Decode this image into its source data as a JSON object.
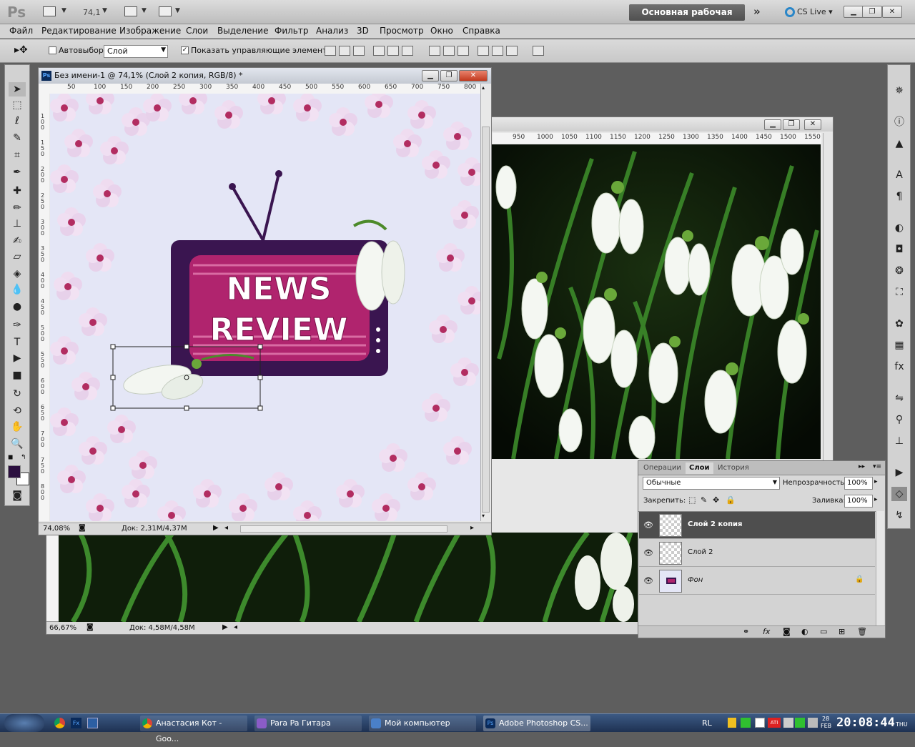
{
  "app": {
    "logo": "Ps",
    "zoom_display": "74,1",
    "workspace": "Основная рабочая среда",
    "cs_live": "CS Live"
  },
  "menu": [
    "Файл",
    "Редактирование",
    "Изображение",
    "Слои",
    "Выделение",
    "Фильтр",
    "Анализ",
    "3D",
    "Просмотр",
    "Окно",
    "Справка"
  ],
  "options": {
    "autoselect_label": "Автовыбор:",
    "autoselect_value": "Слой",
    "show_controls_label": "Показать управляющие элементы"
  },
  "doc1": {
    "title": "Без имени-1 @ 74,1% (Слой 2 копия, RGB/8) *",
    "zoom": "74,08%",
    "doc_size": "Док: 2,31M/4,37M",
    "ruler_ticks": [
      "50",
      "100",
      "150",
      "200",
      "250",
      "300",
      "350",
      "400",
      "450",
      "500",
      "550",
      "600",
      "650",
      "700",
      "750",
      "800"
    ],
    "vruler_ticks": [
      "1 0 0",
      "1 5 0",
      "2 0 0",
      "2 5 0",
      "3 0 0",
      "3 5 0",
      "4 0 0",
      "4 5 0",
      "5 0 0",
      "5 5 0",
      "6 0 0",
      "6 5 0",
      "7 0 0",
      "7 5 0",
      "8 0 0"
    ],
    "artwork": {
      "line1": "NEWS",
      "line2": "REVIEW"
    }
  },
  "doc2": {
    "zoom": "66,67%",
    "doc_size": "Док: 4,58M/4,58M",
    "ruler_ticks": [
      "950",
      "1000",
      "1050",
      "1100",
      "1150",
      "1200",
      "1250",
      "1300",
      "1350",
      "1400",
      "1450",
      "1500",
      "1550"
    ]
  },
  "layers_panel": {
    "tabs": [
      "Операции",
      "Слои",
      "История"
    ],
    "active_tab": "Слои",
    "blend_mode": "Обычные",
    "opacity_label": "Непрозрачность:",
    "opacity": "100%",
    "lock_label": "Закрепить:",
    "fill_label": "Заливка:",
    "fill": "100%",
    "layers": [
      {
        "name": "Слой 2 копия",
        "selected": true
      },
      {
        "name": "Слой 2",
        "selected": false
      },
      {
        "name": "Фон",
        "selected": false,
        "locked": true
      }
    ]
  },
  "taskbar": {
    "tasks": [
      "Анастасия Кот - Goo...",
      "Para Pa Гитара",
      "Мой компьютер",
      "Adobe Photoshop CS..."
    ],
    "lang": "RL",
    "date_top": "28",
    "date_month": "FEB",
    "time": "20:08:44",
    "day": "THU"
  },
  "colors": {
    "foreground": "#2b0f3f",
    "background": "#ffffff",
    "tv_body": "#3a1550",
    "tv_screen": "#b0246e",
    "canvas_bg": "#e4e6f6"
  }
}
